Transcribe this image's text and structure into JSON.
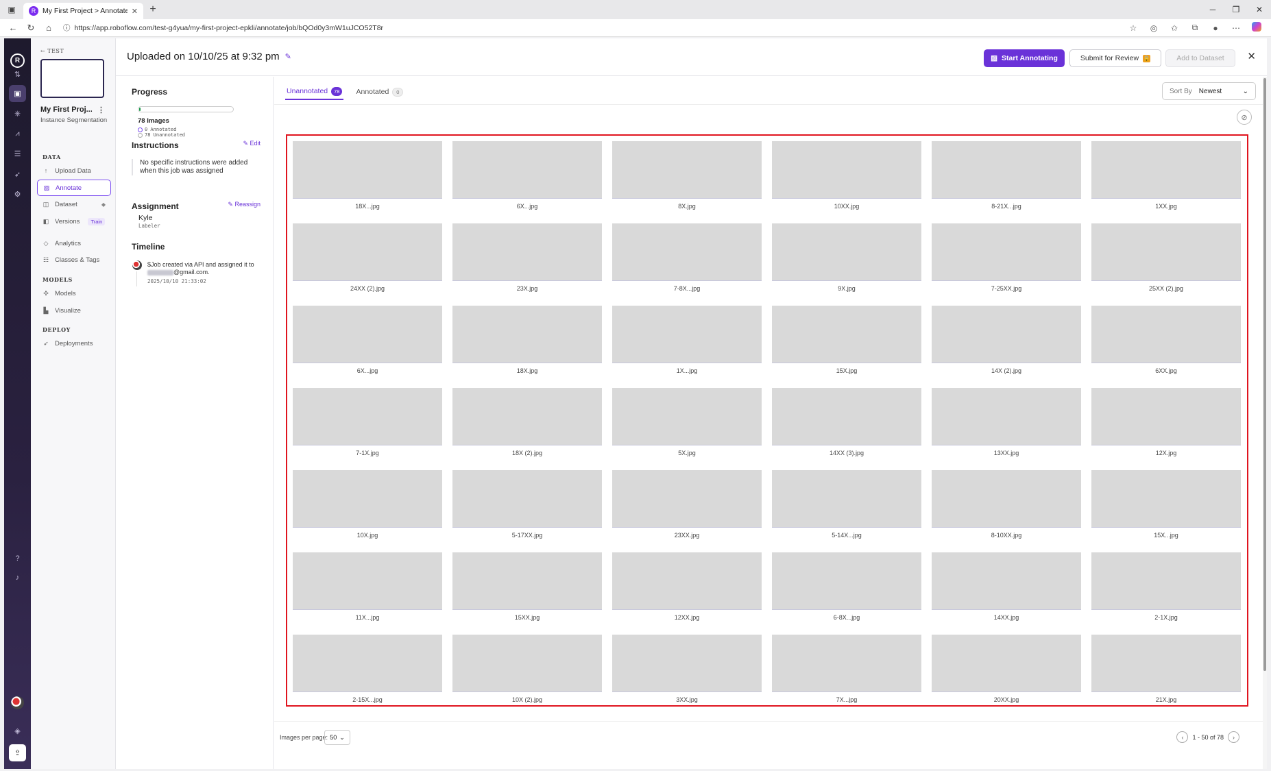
{
  "browser": {
    "tab_title": "My First Project > Annotate",
    "url": "https://app.roboflow.com/test-g4yua/my-first-project-epkli/annotate/job/bQOd0y3mW1uJCO52T8r"
  },
  "sidebar": {
    "workspace": "TEST",
    "project_name": "My First Proj...",
    "project_type": "Instance Segmentation",
    "sections": {
      "data": "DATA",
      "models": "MODELS",
      "deploy": "DEPLOY"
    },
    "items": [
      {
        "label": "Upload Data",
        "icon": "upload-icon"
      },
      {
        "label": "Annotate",
        "icon": "annotate-icon"
      },
      {
        "label": "Dataset",
        "icon": "dataset-icon"
      },
      {
        "label": "Versions",
        "icon": "versions-icon",
        "badge": "Train"
      },
      {
        "label": "Analytics",
        "icon": "analytics-icon"
      },
      {
        "label": "Classes & Tags",
        "icon": "list-icon"
      },
      {
        "label": "Models",
        "icon": "models-icon"
      },
      {
        "label": "Visualize",
        "icon": "chart-icon"
      },
      {
        "label": "Deployments",
        "icon": "rocket-icon"
      }
    ]
  },
  "header": {
    "title": "Uploaded on 10/10/25 at 9:32 pm",
    "start_annotating": "Start Annotating",
    "submit_review": "Submit for Review",
    "add_to_dataset": "Add to Dataset"
  },
  "job": {
    "progress_title": "Progress",
    "progress_fraction": 0,
    "images_count": "78 Images",
    "annotated_legend": "0 Annotated",
    "unannotated_legend": "78 Unannotated",
    "instructions_title": "Instructions",
    "edit_label": "Edit",
    "instructions_text": "No specific instructions were added when this job was assigned",
    "assignment_title": "Assignment",
    "reassign_label": "Reassign",
    "assignee": "Kyle",
    "assignee_role": "Labeler",
    "timeline_title": "Timeline",
    "timeline_text_1": "$Job created via API and assigned it to",
    "timeline_text_2": "@gmail.com.",
    "timeline_time": "2025/10/10 21:33:02"
  },
  "tabs": {
    "unannotated_label": "Unannotated",
    "unannotated_count": "78",
    "annotated_label": "Annotated",
    "annotated_count": "0"
  },
  "sort": {
    "label": "Sort By",
    "value": "Newest"
  },
  "images": [
    "18X...jpg",
    "6X...jpg",
    "8X.jpg",
    "10XX.jpg",
    "8-21X...jpg",
    "1XX.jpg",
    "24XX (2).jpg",
    "23X.jpg",
    "7-8X...jpg",
    "9X.jpg",
    "7-25XX.jpg",
    "25XX (2).jpg",
    "6X...jpg",
    "18X.jpg",
    "1X...jpg",
    "15X.jpg",
    "14X (2).jpg",
    "6XX.jpg",
    "7-1X.jpg",
    "18X (2).jpg",
    "5X.jpg",
    "14XX (3).jpg",
    "13XX.jpg",
    "12X.jpg",
    "10X.jpg",
    "5-17XX.jpg",
    "23XX.jpg",
    "5-14X...jpg",
    "8-10XX.jpg",
    "15X...jpg",
    "11X...jpg",
    "15XX.jpg",
    "12XX.jpg",
    "6-8X...jpg",
    "14XX.jpg",
    "2-1X.jpg",
    "2-15X...jpg",
    "10X (2).jpg",
    "3XX.jpg",
    "7X...jpg",
    "20XX.jpg",
    "21X.jpg"
  ],
  "footer": {
    "images_per_page_label": "Images per page:",
    "images_per_page_value": "50",
    "pagination": "1 - 50 of 78"
  },
  "colors": {
    "accent": "#6a32d8",
    "highlight_border": "#e0141e",
    "placeholder": "#d9d9d9"
  }
}
